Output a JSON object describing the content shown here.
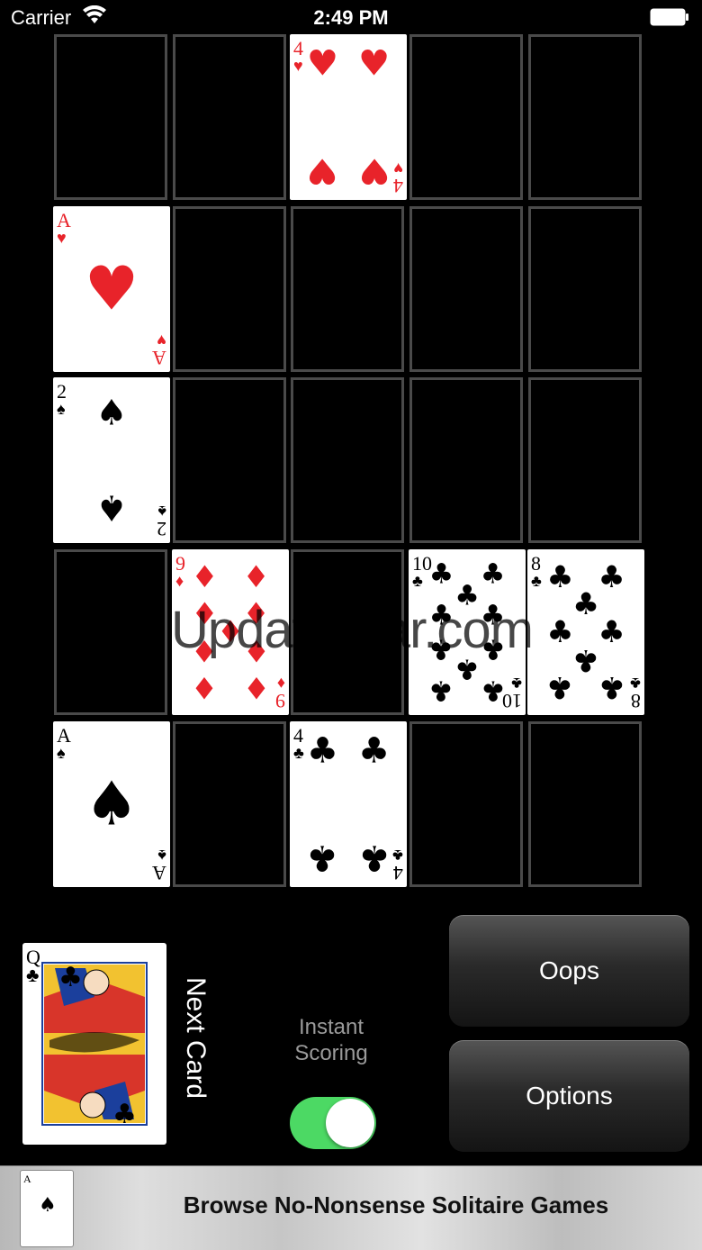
{
  "status_bar": {
    "carrier": "Carrier",
    "time": "2:49 PM"
  },
  "grid": {
    "cards": [
      {
        "rank": "4",
        "suit": "♥",
        "color": "red"
      },
      {
        "rank": "A",
        "suit": "♥",
        "color": "red"
      },
      {
        "rank": "2",
        "suit": "♠",
        "color": "black"
      },
      {
        "rank": "9",
        "suit": "♦",
        "color": "red"
      },
      {
        "rank": "10",
        "suit": "♣",
        "color": "black"
      },
      {
        "rank": "8",
        "suit": "♣",
        "color": "black"
      },
      {
        "rank": "A",
        "suit": "♠",
        "color": "black"
      },
      {
        "rank": "4",
        "suit": "♣",
        "color": "black"
      }
    ]
  },
  "next_card": {
    "rank": "Q",
    "suit": "♣",
    "label": "Next Card"
  },
  "instant_scoring": {
    "label_line1": "Instant",
    "label_line2": "Scoring",
    "enabled": true
  },
  "buttons": {
    "oops": "Oops",
    "options": "Options"
  },
  "banner": {
    "text": "Browse No-Nonsense Solitaire Games",
    "card_rank": "A",
    "card_suit": "♠"
  },
  "watermark": "UpdateStar.com",
  "colors": {
    "red_suit": "#e8232a",
    "toggle_on": "#4cd964",
    "cell_border": "#4a4a4a"
  }
}
